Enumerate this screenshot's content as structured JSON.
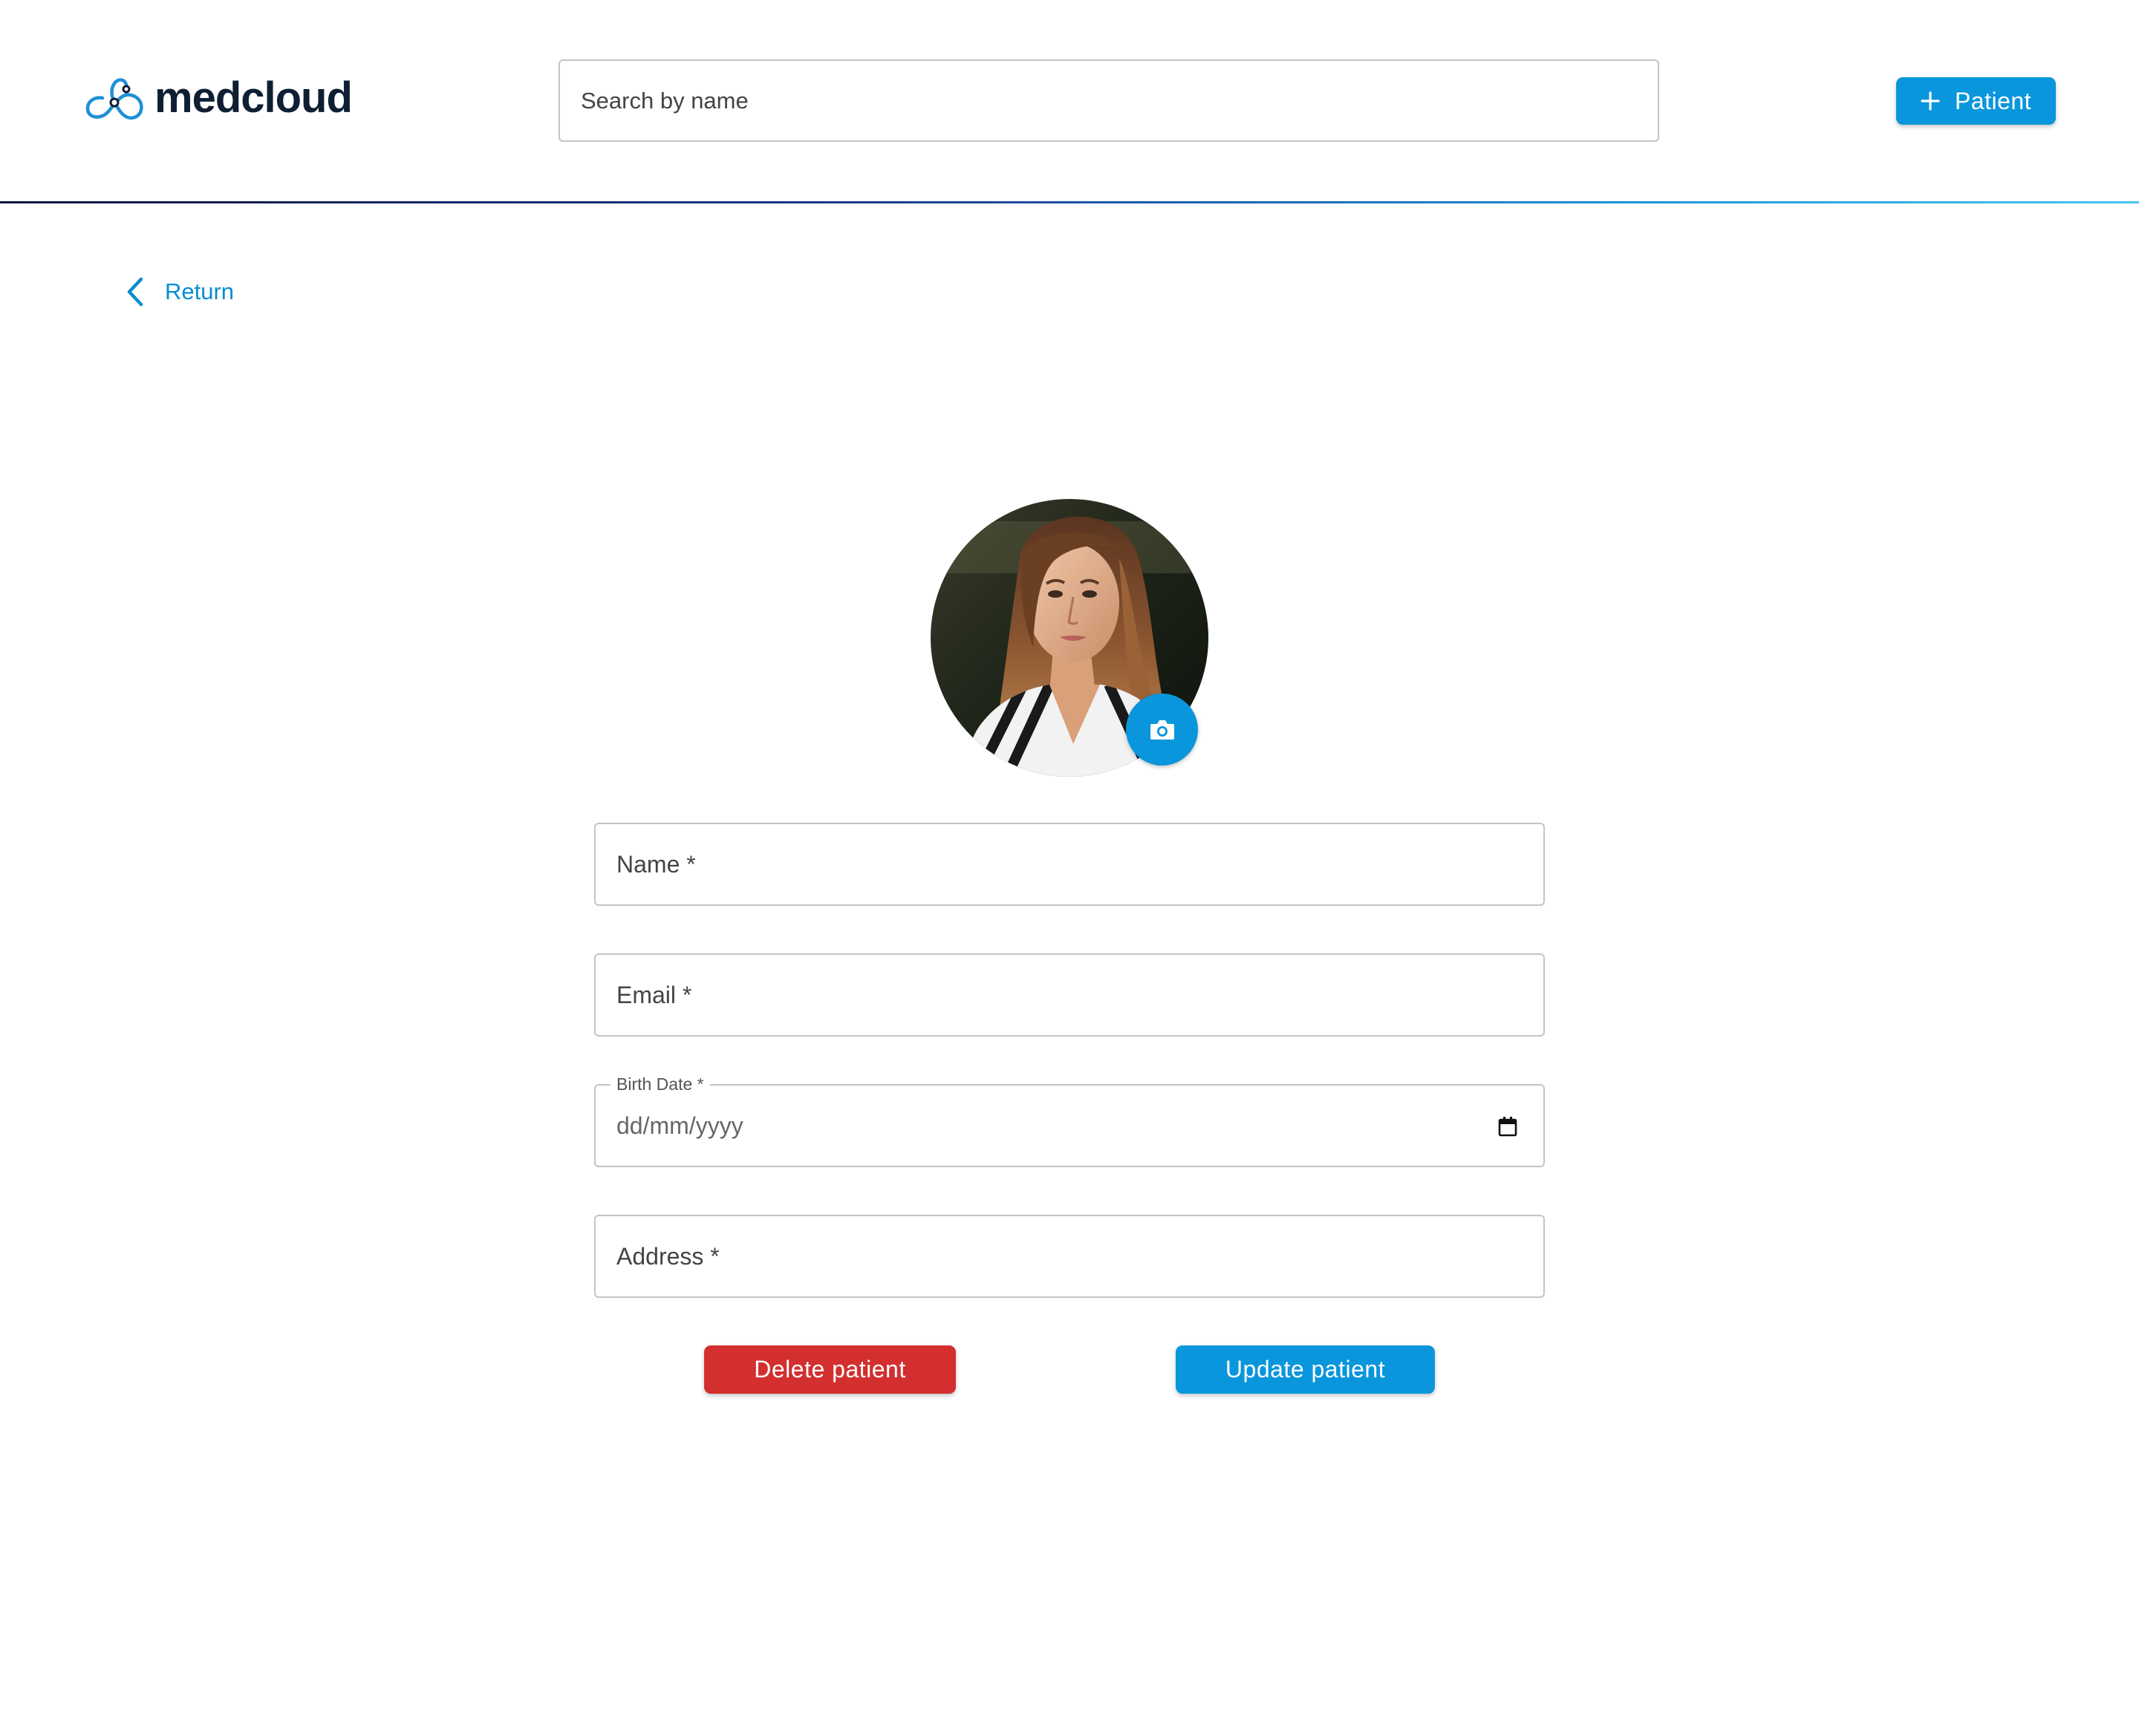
{
  "header": {
    "logo_text": "medcloud",
    "search_placeholder": "Search by name",
    "add_patient_label": "Patient"
  },
  "nav": {
    "return_label": "Return"
  },
  "form": {
    "name_placeholder": "Name *",
    "email_placeholder": "Email *",
    "birth_date_label": "Birth Date *",
    "birth_date_value": "dd/mm/yyyy",
    "address_placeholder": "Address *",
    "delete_label": "Delete patient",
    "update_label": "Update patient"
  },
  "icons": {
    "logo": "cloud-link-logo-icon",
    "add": "plus-icon",
    "back": "chevron-left-icon",
    "camera": "camera-icon",
    "calendar": "calendar-icon"
  },
  "colors": {
    "primary": "#0a96dc",
    "danger": "#d32f2f",
    "logo_text": "#0f1f33",
    "link": "#0a8dd1"
  }
}
